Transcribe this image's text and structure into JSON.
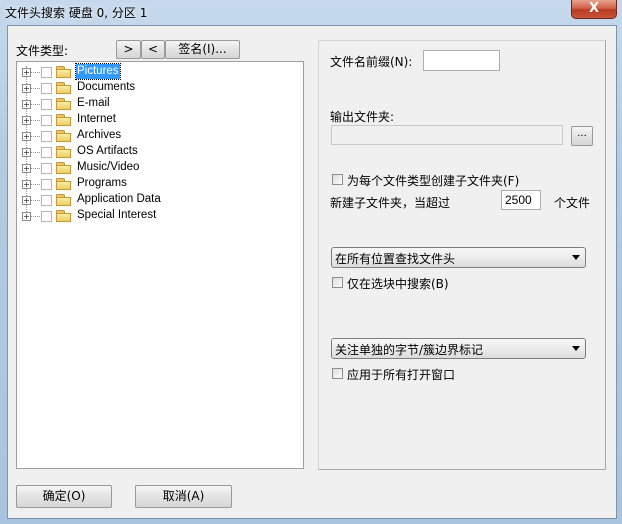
{
  "window": {
    "title": "文件头搜索 硬盘 0, 分区 1",
    "close_label": "X"
  },
  "left": {
    "file_types_label": "文件类型:",
    "forward_button": ">",
    "back_button": "<",
    "signatures_button": "签名(I)...",
    "tree": [
      {
        "label": "Pictures",
        "selected": true
      },
      {
        "label": "Documents"
      },
      {
        "label": "E-mail"
      },
      {
        "label": "Internet"
      },
      {
        "label": "Archives"
      },
      {
        "label": "OS Artifacts"
      },
      {
        "label": "Music/Video"
      },
      {
        "label": "Programs"
      },
      {
        "label": "Application Data"
      },
      {
        "label": "Special Interest"
      }
    ]
  },
  "right": {
    "filename_prefix_label": "文件名前缀(N):",
    "filename_prefix_value": "",
    "output_folder_label": "输出文件夹:",
    "output_folder_value": "",
    "browse_button": "...",
    "create_subfolder_checkbox": "为每个文件类型创建子文件夹(F)",
    "create_subfolder_checked": false,
    "new_subfolder_label": "新建子文件夹，当超过",
    "new_subfolder_threshold": "2500",
    "files_unit_label": "个文件",
    "search_location_select": "在所有位置查找文件头",
    "search_block_only_checkbox": "仅在选块中搜索(B)",
    "search_block_only_checked": false,
    "focus_select": "关注单独的字节/簇边界标记",
    "apply_all_windows_checkbox": "应用于所有打开窗口",
    "apply_all_windows_checked": false
  },
  "footer": {
    "ok_button": "确定(O)",
    "cancel_button": "取消(A)"
  }
}
